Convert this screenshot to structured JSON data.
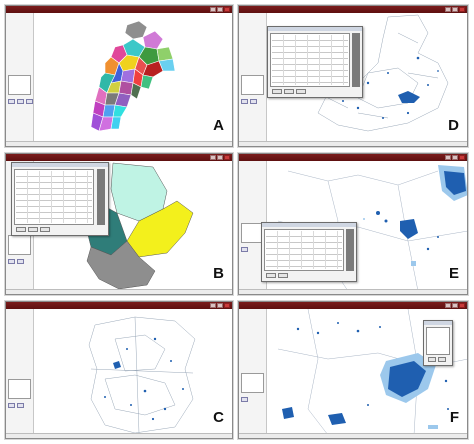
{
  "panels": [
    {
      "id": "A",
      "letter": "A",
      "view": "district-map"
    },
    {
      "id": "B",
      "letter": "B",
      "view": "region-map-with-table"
    },
    {
      "id": "C",
      "letter": "C",
      "view": "waterbody-map"
    },
    {
      "id": "D",
      "letter": "D",
      "view": "waterbody-map-with-table"
    },
    {
      "id": "E",
      "letter": "E",
      "view": "zoomed-waterbody-with-table"
    },
    {
      "id": "F",
      "letter": "F",
      "view": "zoomed-waterbody-with-tool"
    }
  ],
  "colors": {
    "titlebar": "#6b1616",
    "water_dark": "#1f5fb0",
    "water_light": "#9cc8ec",
    "region_yellow": "#f3f01c",
    "region_teal": "#2f7d79",
    "region_mint": "#bff3e4",
    "region_gray": "#8e8e8e"
  }
}
